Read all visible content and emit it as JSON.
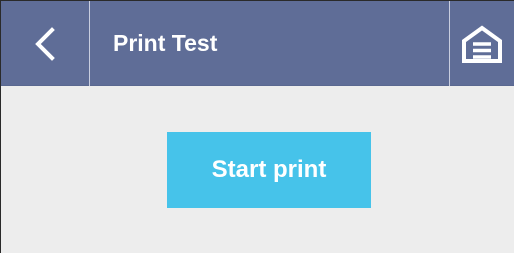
{
  "header": {
    "title": "Print Test",
    "back_icon": "chevron-left-icon",
    "home_icon": "home-icon",
    "background_color": "#5f6d97"
  },
  "main": {
    "start_button_label": "Start print",
    "start_button_color": "#46c3ea",
    "background_color": "#ededed"
  }
}
